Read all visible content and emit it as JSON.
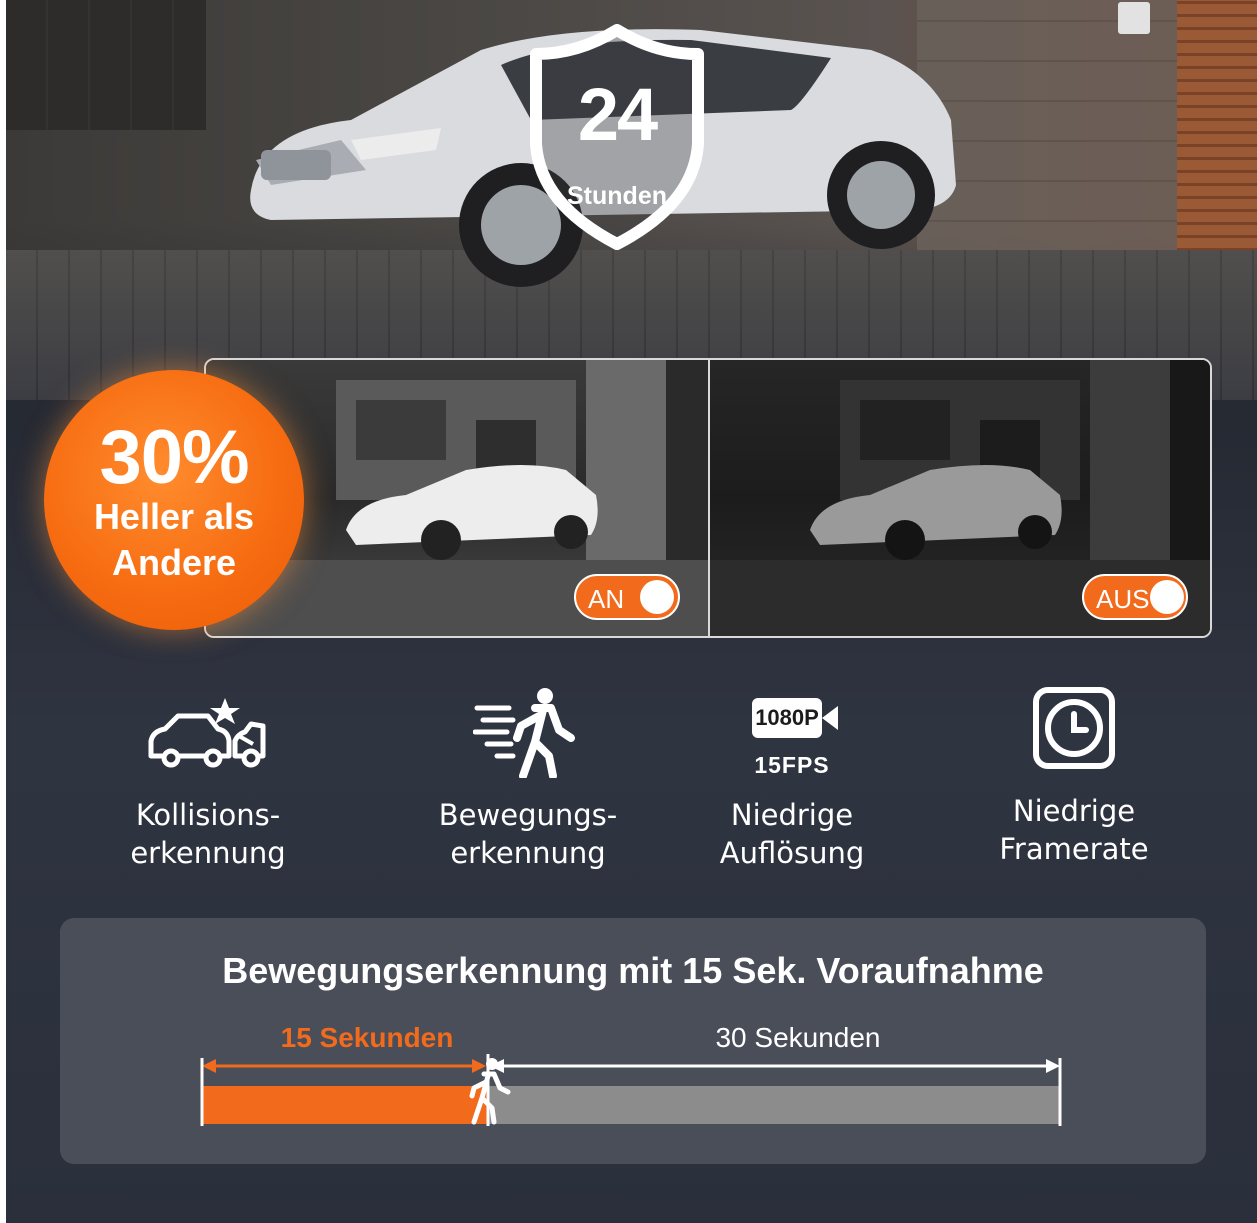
{
  "hero": {
    "shield_number": "24",
    "shield_label": "Stunden"
  },
  "badge": {
    "percent": "30%",
    "line1": "Heller als",
    "line2": "Andere",
    "color": "#f26a1b"
  },
  "comparison": {
    "on_label": "AN",
    "off_label": "AUS",
    "toggle_color": "#f26a1b"
  },
  "features": [
    {
      "icon": "collision-icon",
      "line1": "Kollisions-",
      "line2": "erkennung"
    },
    {
      "icon": "motion-icon",
      "line1": "Bewegungs-",
      "line2": "erkennung"
    },
    {
      "icon": "resolution-icon",
      "badge": "1080P",
      "fps": "15FPS",
      "line1": "Niedrige",
      "line2": "Auflösung"
    },
    {
      "icon": "clock-icon",
      "line1": "Niedrige",
      "line2": "Framerate"
    }
  ],
  "timeline": {
    "title": "Bewegungserkennung mit 15 Sek. Voraufnahme",
    "pre_label": "15 Sekunden",
    "post_label": "30 Sekunden",
    "pre_seconds": 15,
    "post_seconds": 30,
    "pre_color": "#f26a1b",
    "post_color": "#8c8c8c"
  }
}
